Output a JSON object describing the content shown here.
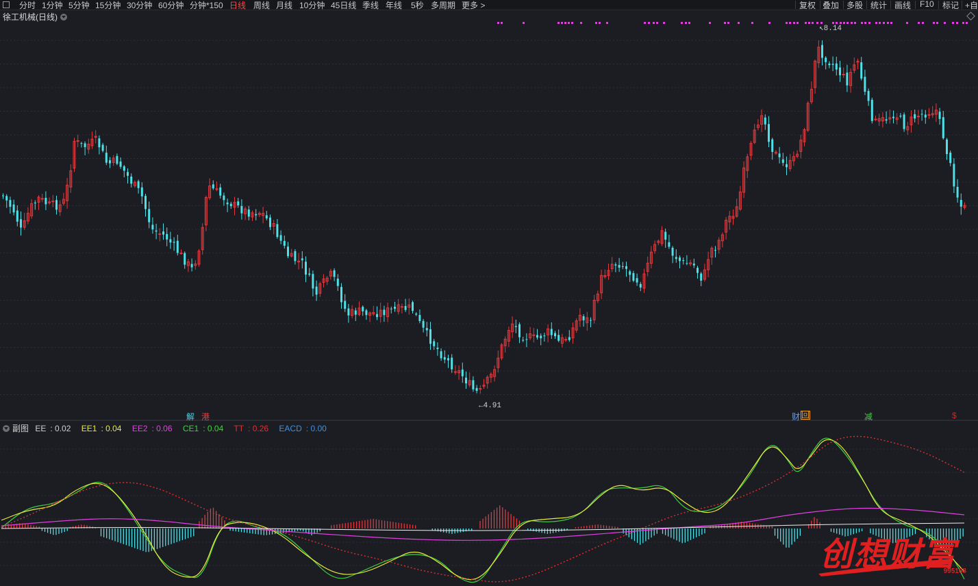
{
  "toolbar": {
    "periods": [
      "分时",
      "1分钟",
      "5分钟",
      "15分钟",
      "30分钟",
      "60分钟",
      "分钟*150",
      "日线",
      "周线",
      "月线",
      "10分钟",
      "45日线",
      "季线",
      "年线",
      "5秒",
      "多周期",
      "更多 >"
    ],
    "active_period": "日线",
    "right": [
      "复权",
      "叠加",
      "多股",
      "统计",
      "画线",
      "F10",
      "标记",
      "+自"
    ]
  },
  "stock": {
    "title": "徐工机械(日线)"
  },
  "price_labels": {
    "high": "8.14",
    "low": "4.91"
  },
  "event_marks": [
    {
      "text": "解",
      "color": "#4ecde0"
    },
    {
      "text": "港",
      "color": "#e04040"
    },
    {
      "text": "财",
      "color": "#5aa0ff"
    },
    {
      "text": "回",
      "color": "#f0a020"
    },
    {
      "text": "减",
      "color": "#40d040"
    },
    {
      "text": "$",
      "color": "#e02020"
    }
  ],
  "indicator": {
    "label": "副图",
    "items": [
      {
        "name": "EE",
        "value": "0.02",
        "color": "#d0d0d0"
      },
      {
        "name": "EE1",
        "value": "0.04",
        "color": "#e8e840"
      },
      {
        "name": "EE2",
        "value": "0.06",
        "color": "#e040e0"
      },
      {
        "name": "CE1",
        "value": "0.04",
        "color": "#40d040"
      },
      {
        "name": "TT",
        "value": "0.26",
        "color": "#e03030"
      },
      {
        "name": "EACD",
        "value": "0.00",
        "color": "#4090e0"
      }
    ]
  },
  "watermark": {
    "text": "创想财富",
    "sub": "995168"
  },
  "colors": {
    "up": "#e0393e",
    "down": "#4fe0e8",
    "bg": "#1c1d22"
  }
}
